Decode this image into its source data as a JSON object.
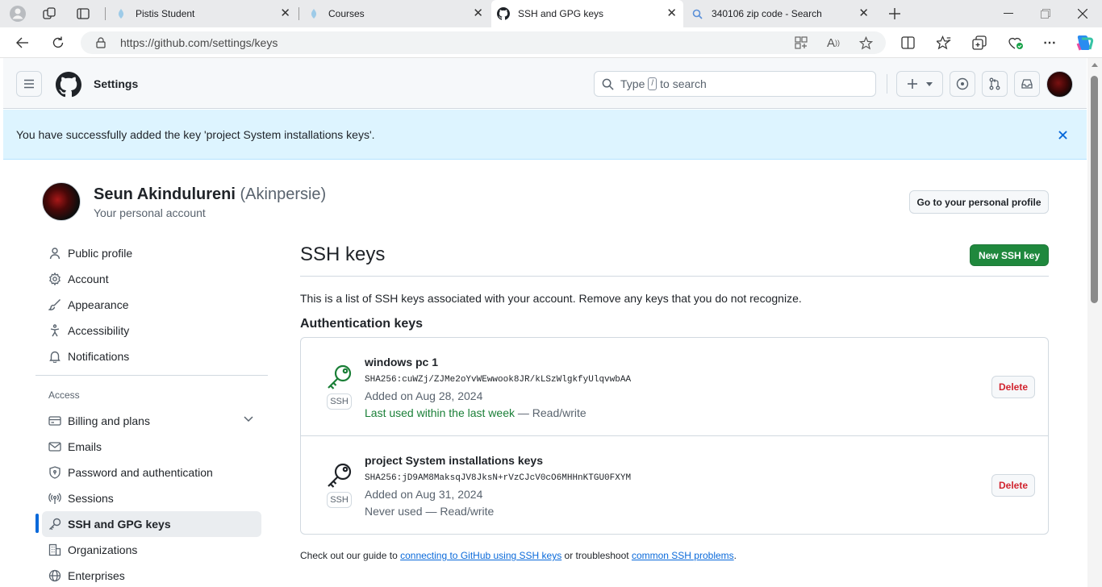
{
  "browser": {
    "tabs": [
      {
        "title": "Pistis Student"
      },
      {
        "title": "Courses"
      },
      {
        "title": "SSH and GPG keys"
      },
      {
        "title": "340106 zip code - Search"
      }
    ],
    "url": "https://github.com/settings/keys"
  },
  "header": {
    "title": "Settings",
    "search_prefix": "Type",
    "search_key": "/",
    "search_suffix": "to search"
  },
  "flash": {
    "message": "You have successfully added the key 'project System installations keys'."
  },
  "profile": {
    "name": "Seun Akindulureni",
    "handle": "(Akinpersie)",
    "subtitle": "Your personal account",
    "profile_button": "Go to your personal profile"
  },
  "sidebar": {
    "items": [
      {
        "label": "Public profile",
        "icon": "person-icon"
      },
      {
        "label": "Account",
        "icon": "gear-icon"
      },
      {
        "label": "Appearance",
        "icon": "paintbrush-icon"
      },
      {
        "label": "Accessibility",
        "icon": "accessibility-icon"
      },
      {
        "label": "Notifications",
        "icon": "bell-icon"
      }
    ],
    "section_label": "Access",
    "access_items": [
      {
        "label": "Billing and plans",
        "icon": "credit-card-icon"
      },
      {
        "label": "Emails",
        "icon": "mail-icon"
      },
      {
        "label": "Password and authentication",
        "icon": "shield-lock-icon"
      },
      {
        "label": "Sessions",
        "icon": "broadcast-icon"
      },
      {
        "label": "SSH and GPG keys",
        "icon": "key-icon",
        "selected": true
      },
      {
        "label": "Organizations",
        "icon": "organization-icon"
      },
      {
        "label": "Enterprises",
        "icon": "globe-icon"
      }
    ]
  },
  "main": {
    "title": "SSH keys",
    "new_button": "New SSH key",
    "description": "This is a list of SSH keys associated with your account. Remove any keys that you do not recognize.",
    "section_title": "Authentication keys",
    "keys": [
      {
        "title": "windows pc 1",
        "fingerprint": "SHA256:cuWZj/ZJMe2oYvWEwwook8JR/kLSzWlgkfyUlqvwbAA",
        "added": "Added on Aug 28, 2024",
        "last_used": "Last used within the last week",
        "access": "— Read/write",
        "badge": "SSH",
        "delete_label": "Delete"
      },
      {
        "title": "project System installations keys",
        "fingerprint": "SHA256:jD9AM8MaksqJV8JksN+rVzCJcV0cO6MHHnKTGU0FXYM",
        "added": "Added on Aug 31, 2024",
        "last_used": "Never used",
        "access": "— Read/write",
        "badge": "SSH",
        "delete_label": "Delete"
      }
    ],
    "footer_prefix": "Check out our guide to",
    "footer_link1": "connecting to GitHub using SSH keys",
    "footer_mid": "or troubleshoot",
    "footer_link2": "common SSH problems",
    "footer_end": "."
  },
  "colors": {
    "primary_button": "#1f883d",
    "flash_bg": "#ddf4ff",
    "active_key": "#1a7f37",
    "danger": "#d1242f",
    "link": "#0969da"
  }
}
